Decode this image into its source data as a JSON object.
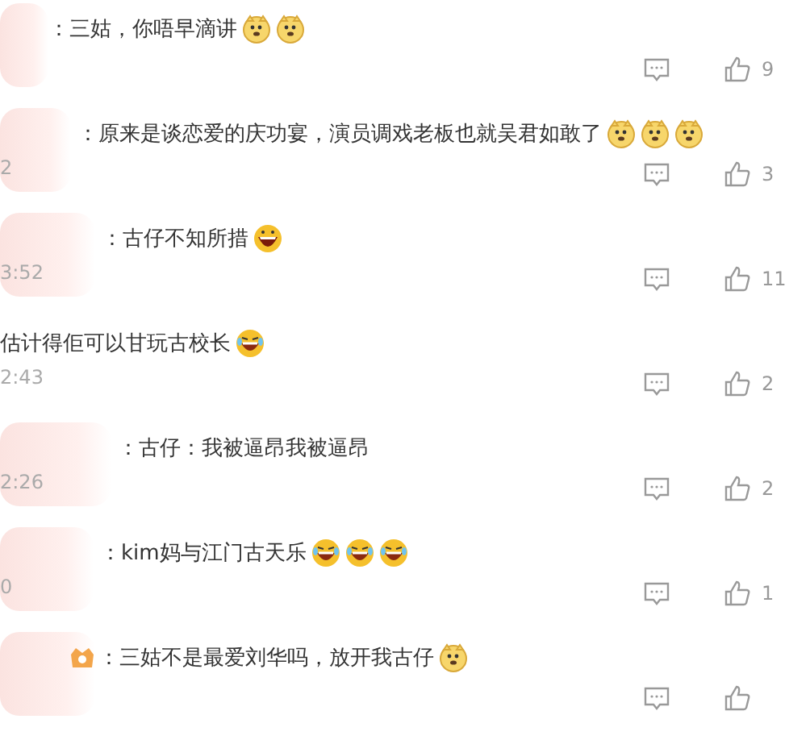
{
  "comments": [
    {
      "text": "：三姑，你唔早滴讲",
      "emojis": [
        {
          "kind": "doge"
        },
        {
          "kind": "doge"
        }
      ],
      "likes": "9"
    },
    {
      "text": "：原来是谈恋爱的庆功宴，演员调戏老板也就吴君如敢了",
      "emojis": [
        {
          "kind": "doge"
        },
        {
          "kind": "doge"
        },
        {
          "kind": "doge"
        }
      ],
      "time": "2",
      "likes": "3"
    },
    {
      "text": "：古仔不知所措",
      "emojis": [
        {
          "kind": "grin"
        }
      ],
      "time": "3:52",
      "likes": "11"
    },
    {
      "text": "估计得佢可以甘玩古校长",
      "emojis": [
        {
          "kind": "laugh"
        }
      ],
      "time": "2:43",
      "likes": "2"
    },
    {
      "text": "：古仔：我被逼昂我被逼昂",
      "time": "2:26",
      "likes": "2"
    },
    {
      "text": "：kim妈与江门古天乐",
      "emojis": [
        {
          "kind": "laugh"
        },
        {
          "kind": "laugh"
        },
        {
          "kind": "laugh"
        }
      ],
      "time": "0",
      "likes": "1"
    },
    {
      "text": "：三姑不是最爱刘华吗，放开我古仔",
      "emojis": [
        {
          "kind": "doge"
        }
      ],
      "badge": true
    }
  ]
}
